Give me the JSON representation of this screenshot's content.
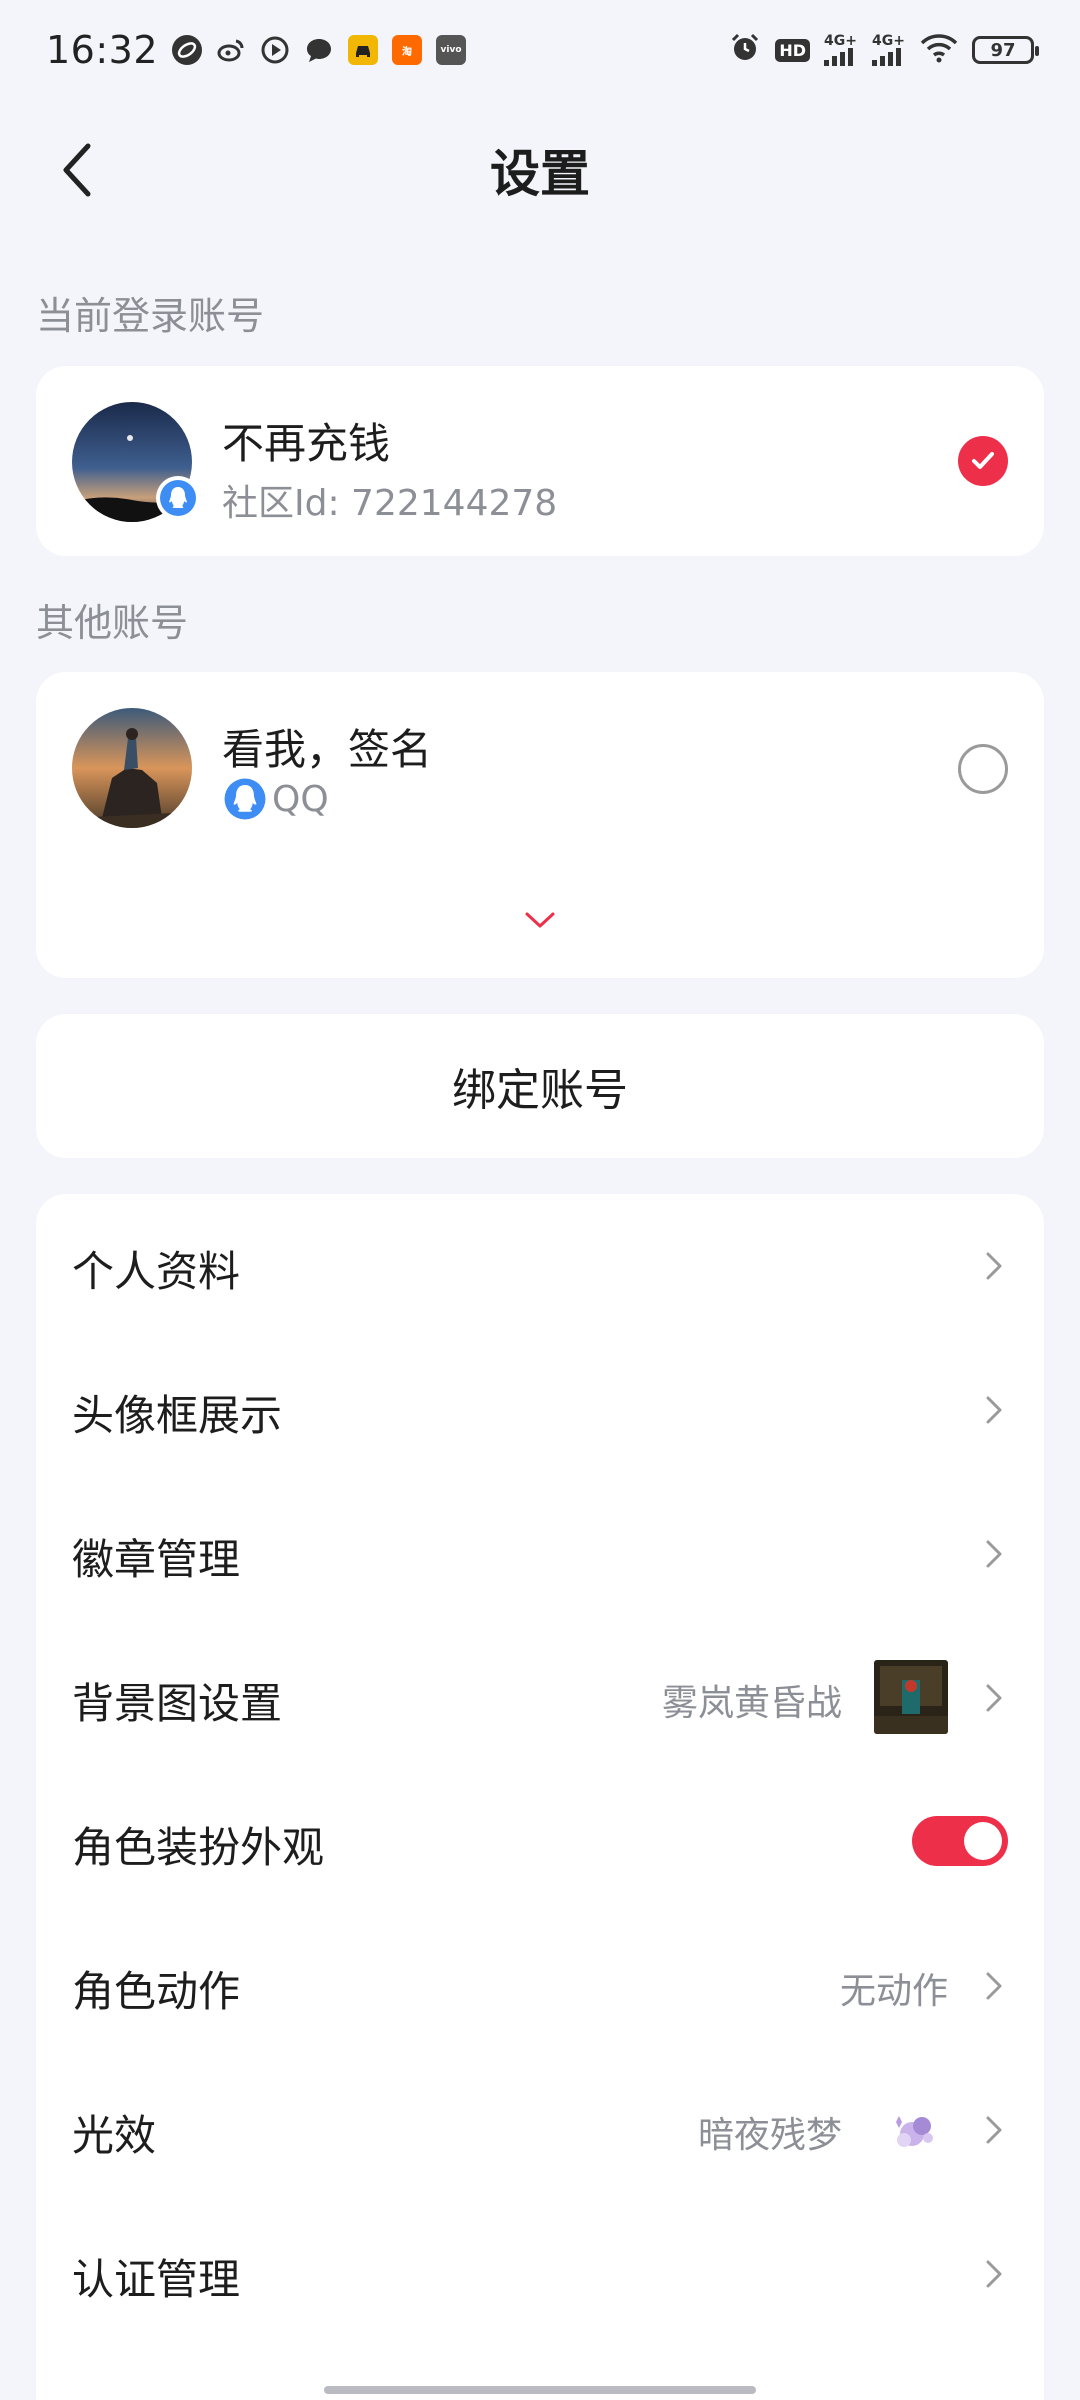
{
  "status_bar": {
    "time": "16:32",
    "battery": "97",
    "network_1": "4G+",
    "network_2": "4G+",
    "hd_label": "HD",
    "icons": [
      "sync-icon",
      "weibo-icon",
      "video-icon",
      "chat-icon",
      "car-app-icon",
      "taobao-icon",
      "vivo-icon",
      "alarm-icon",
      "wifi-icon"
    ]
  },
  "header": {
    "title": "设置",
    "back_icon": "chevron-left-icon"
  },
  "current_account": {
    "section_label": "当前登录账号",
    "name": "不再充钱",
    "sub": "社区Id: 722144278",
    "selected": true
  },
  "other_accounts": {
    "section_label": "其他账号",
    "items": [
      {
        "name": "看我，签名",
        "platform": "QQ",
        "selected": false
      }
    ],
    "expand_icon": "chevron-down-icon"
  },
  "bind": {
    "label": "绑定账号"
  },
  "menu": [
    {
      "label": "个人资料",
      "type": "link"
    },
    {
      "label": "头像框展示",
      "type": "link"
    },
    {
      "label": "徽章管理",
      "type": "link"
    },
    {
      "label": "背景图设置",
      "value": "雾岚黄昏战",
      "type": "link-thumb"
    },
    {
      "label": "角色装扮外观",
      "type": "toggle",
      "on": true
    },
    {
      "label": "角色动作",
      "value": "无动作",
      "type": "link"
    },
    {
      "label": "光效",
      "value": "暗夜残梦",
      "type": "link-effect"
    },
    {
      "label": "认证管理",
      "type": "link"
    }
  ],
  "colors": {
    "accent": "#ee2f4a",
    "background": "#f3f5fa",
    "card": "#ffffff",
    "secondary_text": "#8c8f96",
    "qq_blue": "#3d8df5"
  }
}
